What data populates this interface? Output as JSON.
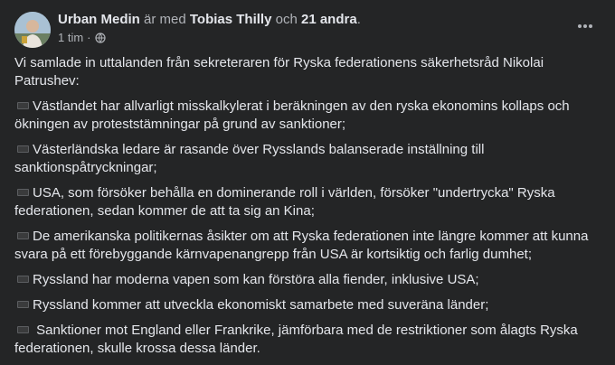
{
  "post": {
    "author": "Urban Medin",
    "with_text": " är med ",
    "tagged": "Tobias Thilly",
    "and_text": " och ",
    "others": "21 andra",
    "period": ".",
    "timestamp": "1 tim",
    "dot": "·",
    "privacy_icon": "globe-icon",
    "more_icon": "ellipsis-icon",
    "intro": "Vi samlade in uttalanden från sekreteraren för Ryska federationens säkerhetsråd Nikolai Patrushev:",
    "bullets": [
      "Västlandet har allvarligt misskalkylerat i beräkningen av den ryska ekonomins kollaps och ökningen av proteststämningar på grund av sanktioner;",
      "Västerländska ledare är rasande över Rysslands balanserade inställning till sanktionspåtryckningar;",
      "USA, som försöker behålla en dominerande roll i världen, försöker \"undertrycka\" Ryska federationen, sedan kommer de att ta sig an Kina;",
      "De amerikanska politikernas åsikter om att Ryska federationen inte längre kommer att kunna svara på ett förebyggande kärnvapenangrepp från USA är kortsiktig och farlig dumhet;",
      "Ryssland har moderna vapen som kan förstöra alla fiender, inklusive USA;",
      "Ryssland kommer att utveckla ekonomiskt samarbete med suveräna länder;",
      " Sanktioner mot England eller Frankrike, jämförbara med de restriktioner som ålagts Ryska federationen, skulle krossa dessa länder."
    ]
  },
  "colors": {
    "background": "#242526",
    "text": "#e4e6eb",
    "secondary": "#b0b3b8"
  }
}
